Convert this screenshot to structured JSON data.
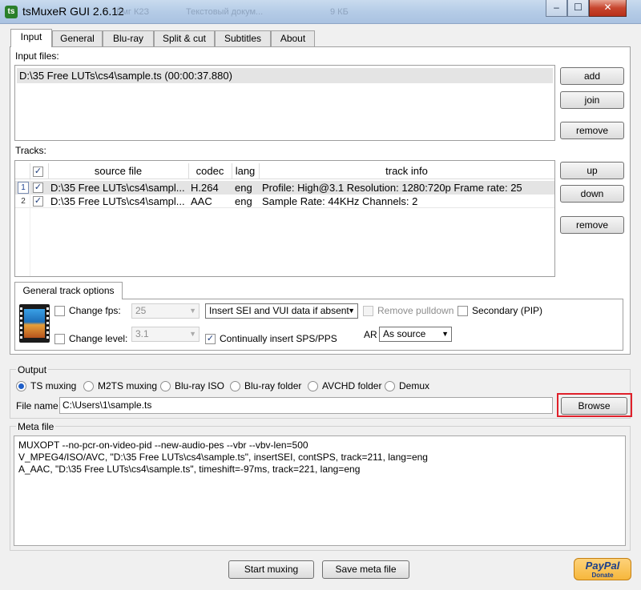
{
  "window": {
    "title": "tsMuxeR GUI 2.6.12",
    "ghost_text_1": "Ёмг К2З",
    "ghost_text_2": "Текстовый докум...",
    "ghost_text_3": "9 КБ",
    "minimize": "–",
    "maximize": "☐",
    "close": "✕"
  },
  "tabs": [
    "Input",
    "General",
    "Blu-ray",
    "Split & cut",
    "Subtitles",
    "About"
  ],
  "input": {
    "files_label": "Input files:",
    "files": [
      "D:\\35 Free LUTs\\cs4\\sample.ts (00:00:37.880)"
    ],
    "add": "add",
    "join": "join",
    "remove": "remove"
  },
  "tracks": {
    "label": "Tracks:",
    "columns": [
      "source file",
      "codec",
      "lang",
      "track info"
    ],
    "rows": [
      {
        "num": "1",
        "checked": true,
        "source": "D:\\35 Free LUTs\\cs4\\sampl...",
        "codec": "H.264",
        "lang": "eng",
        "info": "Profile: High@3.1  Resolution: 1280:720p  Frame rate: 25"
      },
      {
        "num": "2",
        "checked": true,
        "source": "D:\\35 Free LUTs\\cs4\\sampl...",
        "codec": "AAC",
        "lang": "eng",
        "info": "Sample Rate: 44KHz  Channels: 2"
      }
    ],
    "up": "up",
    "down": "down",
    "remove": "remove"
  },
  "track_options": {
    "tab": "General track options",
    "change_fps": "Change fps:",
    "fps_value": "25",
    "sei_value": "Insert SEI and VUI data if absent",
    "remove_pulldown": "Remove pulldown",
    "secondary": "Secondary (PIP)",
    "change_level": "Change level:",
    "level_value": "3.1",
    "continually_insert": "Continually insert SPS/PPS",
    "ar_label": "AR",
    "ar_value": "As source"
  },
  "output": {
    "label": "Output",
    "modes": [
      "TS muxing",
      "M2TS muxing",
      "Blu-ray ISO",
      "Blu-ray folder",
      "AVCHD folder",
      "Demux"
    ],
    "selected": 0,
    "file_name_label": "File name",
    "file_name_value": "C:\\Users\\1\\sample.ts",
    "browse": "Browse"
  },
  "meta": {
    "label": "Meta file",
    "lines": [
      "MUXOPT --no-pcr-on-video-pid --new-audio-pes --vbr  --vbv-len=500",
      "V_MPEG4/ISO/AVC, \"D:\\35 Free LUTs\\cs4\\sample.ts\", insertSEI, contSPS, track=211, lang=eng",
      "A_AAC, \"D:\\35 Free LUTs\\cs4\\sample.ts\", timeshift=-97ms, track=221, lang=eng"
    ]
  },
  "footer": {
    "start_muxing": "Start muxing",
    "save_meta": "Save meta file",
    "paypal": "PayPal",
    "donate": "Donate"
  },
  "colors": {
    "browse_highlight": "#e0202a",
    "selection_row": "#e4e4e4",
    "paypal_yellow": "#f6b73c",
    "paypal_blue": "#1b3f8c"
  }
}
